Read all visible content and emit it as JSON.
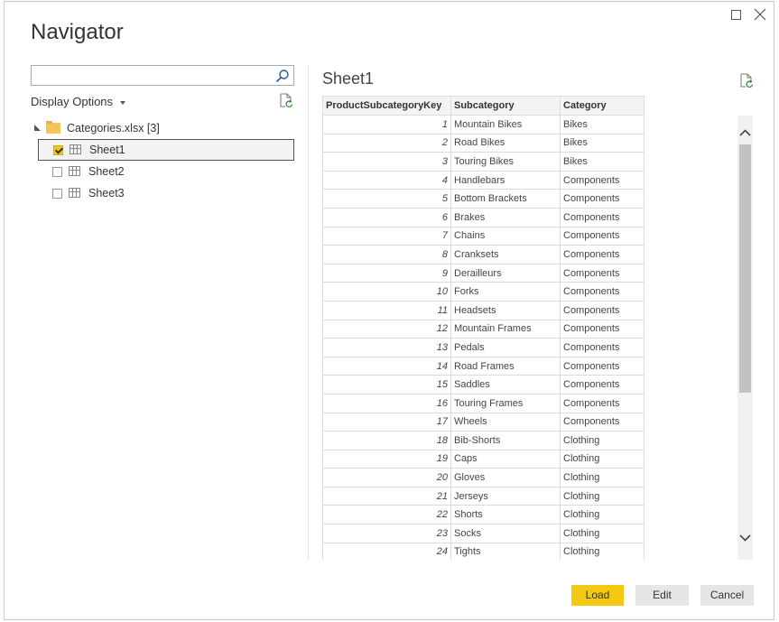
{
  "window": {
    "title": "Navigator"
  },
  "search": {
    "value": "",
    "placeholder": ""
  },
  "left_panel": {
    "display_options_label": "Display Options",
    "tree": {
      "root_label": "Categories.xlsx [3]",
      "items": [
        {
          "label": "Sheet1",
          "checked": true,
          "selected": true
        },
        {
          "label": "Sheet2",
          "checked": false,
          "selected": false
        },
        {
          "label": "Sheet3",
          "checked": false,
          "selected": false
        }
      ]
    }
  },
  "preview": {
    "title": "Sheet1",
    "columns": [
      "ProductSubcategoryKey",
      "Subcategory",
      "Category"
    ],
    "rows": [
      [
        "1",
        "Mountain Bikes",
        "Bikes"
      ],
      [
        "2",
        "Road Bikes",
        "Bikes"
      ],
      [
        "3",
        "Touring Bikes",
        "Bikes"
      ],
      [
        "4",
        "Handlebars",
        "Components"
      ],
      [
        "5",
        "Bottom Brackets",
        "Components"
      ],
      [
        "6",
        "Brakes",
        "Components"
      ],
      [
        "7",
        "Chains",
        "Components"
      ],
      [
        "8",
        "Cranksets",
        "Components"
      ],
      [
        "9",
        "Derailleurs",
        "Components"
      ],
      [
        "10",
        "Forks",
        "Components"
      ],
      [
        "11",
        "Headsets",
        "Components"
      ],
      [
        "12",
        "Mountain Frames",
        "Components"
      ],
      [
        "13",
        "Pedals",
        "Components"
      ],
      [
        "14",
        "Road Frames",
        "Components"
      ],
      [
        "15",
        "Saddles",
        "Components"
      ],
      [
        "16",
        "Touring Frames",
        "Components"
      ],
      [
        "17",
        "Wheels",
        "Components"
      ],
      [
        "18",
        "Bib-Shorts",
        "Clothing"
      ],
      [
        "19",
        "Caps",
        "Clothing"
      ],
      [
        "20",
        "Gloves",
        "Clothing"
      ],
      [
        "21",
        "Jerseys",
        "Clothing"
      ],
      [
        "22",
        "Shorts",
        "Clothing"
      ],
      [
        "23",
        "Socks",
        "Clothing"
      ],
      [
        "24",
        "Tights",
        "Clothing"
      ]
    ]
  },
  "buttons": {
    "load": "Load",
    "edit": "Edit",
    "cancel": "Cancel"
  },
  "colors": {
    "accent": "#f2c811",
    "folder": "#f5c45b",
    "secondary_button": "#e6e6e6"
  },
  "icons": [
    "maximize-icon",
    "close-icon",
    "search-icon",
    "refresh-icon",
    "collapse-triangle-icon",
    "folder-icon",
    "table-icon",
    "chevron-up-icon",
    "chevron-down-icon"
  ]
}
